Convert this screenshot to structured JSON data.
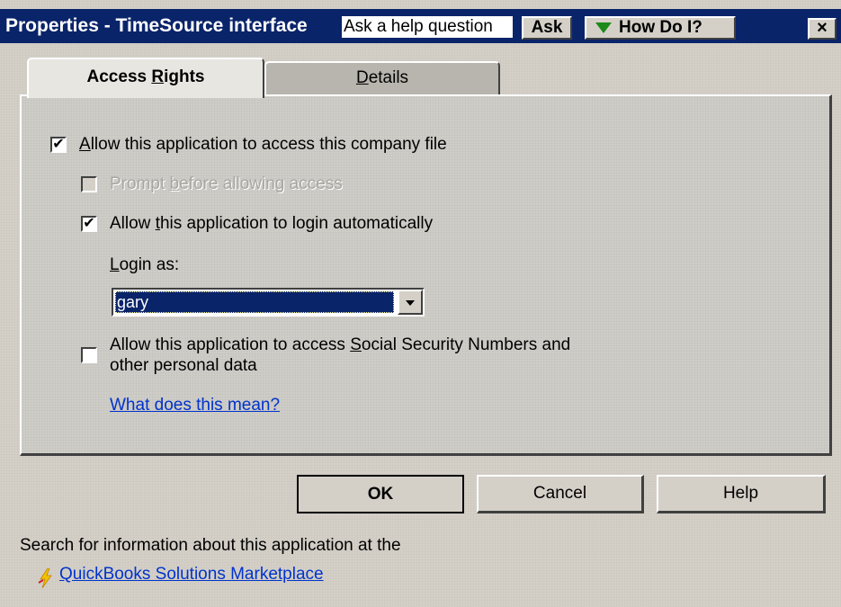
{
  "window": {
    "title": "Properties - TimeSource interface",
    "help_placeholder": "Ask a help question",
    "ask_label": "Ask",
    "howdoi_label": "How Do I?",
    "close_label": "×"
  },
  "tabs": [
    {
      "label": "Access Rights",
      "mnemonic": "R",
      "selected": true
    },
    {
      "label": "Details",
      "mnemonic": "D",
      "selected": false
    }
  ],
  "access": {
    "allow_access": {
      "label": "Allow this application to access this company file",
      "checked": true,
      "enabled": true
    },
    "prompt_before": {
      "label": "Prompt before allowing access",
      "checked": false,
      "enabled": false
    },
    "login_auto": {
      "label": "Allow this application to login automatically",
      "checked": true,
      "enabled": true
    },
    "login_as_label": "Login as:",
    "login_as_value": "gary",
    "ssn": {
      "label_line1": "Allow this application to access Social Security Numbers and",
      "label_line2": "other personal data",
      "checked": false,
      "enabled": true
    },
    "what_link": "What does this mean?"
  },
  "buttons": {
    "ok": "OK",
    "cancel": "Cancel",
    "help": "Help"
  },
  "footer": {
    "search_text": "Search for information about this application at the",
    "marketplace_link": "QuickBooks Solutions Marketplace"
  },
  "colors": {
    "title_bar": "#0a246a",
    "dialog_bg": "#d4d0c8",
    "link": "#0033cc",
    "howdoi_triangle": "#1a8a1a"
  }
}
